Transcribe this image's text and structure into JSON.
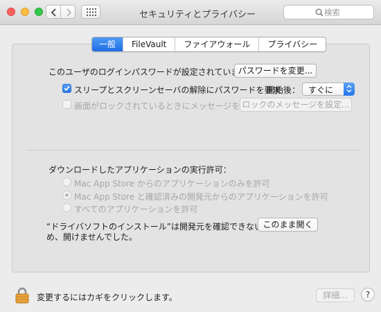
{
  "window": {
    "title": "セキュリティとプライバシー",
    "search_placeholder": "検索"
  },
  "tabs": [
    {
      "label": "一般",
      "active": true
    },
    {
      "label": "FileVault",
      "active": false
    },
    {
      "label": "ファイアウォール",
      "active": false
    },
    {
      "label": "プライバシー",
      "active": false
    }
  ],
  "general": {
    "password_label": "このユーザのログインパスワードが設定されています",
    "change_password_button": "パスワードを変更...",
    "require_password_label": "スリープとスクリーンセーバの解除にパスワードを要求",
    "require_password_checked": true,
    "after_label": "開始後：",
    "after_value": "すぐに",
    "show_message_label": "画面がロックされているときにメッセージを表示",
    "show_message_checked": false,
    "set_lock_message_button": "ロックのメッセージを設定..."
  },
  "downloads": {
    "heading": "ダウンロードしたアプリケーションの実行許可：",
    "options": [
      {
        "label": "Mac App Store からのアプリケーションのみを許可",
        "selected": false
      },
      {
        "label": "Mac App Store と確認済みの開発元からのアプリケーションを許可",
        "selected": true
      },
      {
        "label": "すべてのアプリケーションを許可",
        "selected": false
      }
    ],
    "blocked_line1": "“ドライバソフトのインストール”は開発元を確認できないた",
    "blocked_line2": "め、開けませんでした。",
    "open_anyway_button": "このまま開く"
  },
  "footer": {
    "lock_text": "変更するにはカギをクリックします。",
    "advanced_button": "詳細...",
    "help_button": "?"
  },
  "colors": {
    "accent": "#2576ea",
    "window_bg": "#ececec",
    "panel_bg": "#e3e3e3",
    "lock": "#e6a23a"
  },
  "icons": [
    "close-light",
    "minimize-light",
    "zoom-light",
    "back-chevron-icon",
    "forward-chevron-icon",
    "show-all-grid-icon",
    "search-icon",
    "checkmark-icon",
    "popup-arrows-icon",
    "lock-icon",
    "help-icon"
  ]
}
